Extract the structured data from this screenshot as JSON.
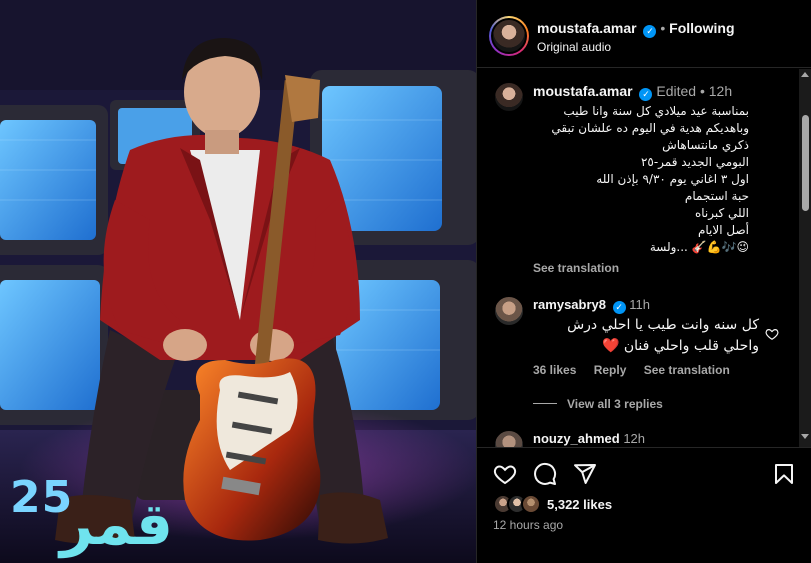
{
  "media": {
    "watermark_number": "25",
    "watermark_word": "قمر"
  },
  "header": {
    "username": "moustafa.amar",
    "separator": "•",
    "follow_status": "Following",
    "audio_label": "Original audio"
  },
  "caption": {
    "username": "moustafa.amar",
    "edited_label": "Edited",
    "separator": "•",
    "time": "12h",
    "lines": [
      "بمناسبة عيد ميلادي كل سنة وانا طيب",
      "وباهديكم هدية في اليوم ده علشان تبقي",
      "ذكري مانتساهاش",
      "البومي الجديد قمر-٢٥",
      "اول ٣ اغاني يوم ٩/٣٠ بإذن الله",
      "حبة استجمام",
      "اللي كبرناه",
      "أصل الايام",
      "😉🎶💪🎸 ...ولسة"
    ],
    "see_translation": "See translation"
  },
  "comments": [
    {
      "username": "ramysabry8",
      "time": "11h",
      "lines": [
        "كل سنه وانت طيب يا احلي درش",
        "واحلي قلب واحلي فنان ❤️"
      ],
      "likes": "36 likes",
      "reply_label": "Reply",
      "see_translation": "See translation",
      "view_replies": "View all 3 replies"
    },
    {
      "username": "nouzy_ahmed",
      "time": "12h"
    }
  ],
  "footer": {
    "likes": "5,322 likes",
    "posted": "12 hours ago"
  },
  "icons": {
    "like": "heart-icon",
    "comment": "comment-icon",
    "share": "share-icon",
    "save": "bookmark-icon",
    "verified": "verified-badge-icon",
    "comment_like": "heart-outline-icon"
  },
  "colors": {
    "background": "#000000",
    "text_primary": "#f5f5f5",
    "text_secondary": "#a8a8a8",
    "verified_blue": "#0095f6",
    "divider": "#262626"
  }
}
